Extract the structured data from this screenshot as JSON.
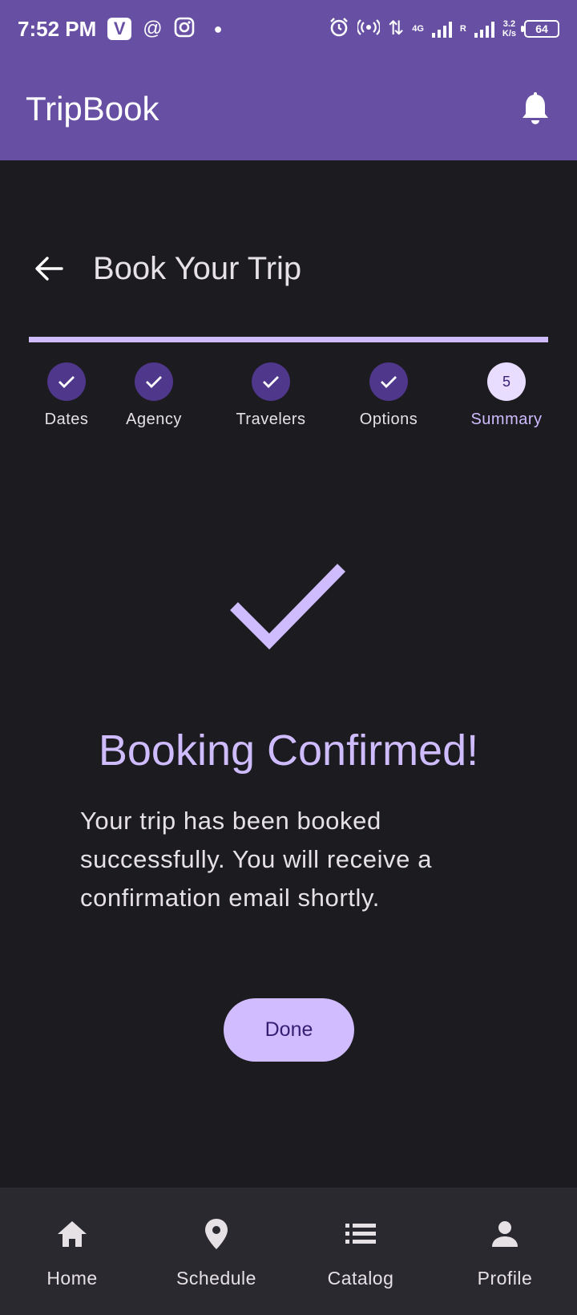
{
  "status_bar": {
    "time": "7:52 PM",
    "app_badge": "V",
    "network": "4G",
    "roaming": "R",
    "speed_value": "3.2",
    "speed_unit": "K/s",
    "battery": "64",
    "icons": [
      "threads-icon",
      "instagram-icon",
      "alarm-icon",
      "hotspot-icon",
      "signal-icon"
    ]
  },
  "app_bar": {
    "title": "TripBook",
    "action_icon": "bell-icon"
  },
  "page": {
    "title": "Book Your Trip",
    "back_icon": "arrow-left-icon"
  },
  "stepper": {
    "progress": 1.0,
    "steps": [
      {
        "label": "Dates",
        "state": "complete"
      },
      {
        "label": "Agency",
        "state": "complete"
      },
      {
        "label": "Travelers",
        "state": "complete"
      },
      {
        "label": "Options",
        "state": "complete"
      },
      {
        "label": "Summary",
        "state": "active",
        "number": "5"
      }
    ]
  },
  "confirmation": {
    "icon": "check-icon",
    "title": "Booking Confirmed!",
    "message": "Your trip has been booked successfully. You will receive a confirmation email shortly.",
    "button_label": "Done"
  },
  "bottom_nav": {
    "items": [
      {
        "label": "Home",
        "icon": "home-icon"
      },
      {
        "label": "Schedule",
        "icon": "location-pin-icon"
      },
      {
        "label": "Catalog",
        "icon": "list-icon"
      },
      {
        "label": "Profile",
        "icon": "person-icon"
      }
    ]
  },
  "colors": {
    "primary": "#6750a4",
    "background": "#1c1b1f",
    "accent": "#cfbcff",
    "step_complete": "#4f378b",
    "nav_background": "#2b2930"
  }
}
